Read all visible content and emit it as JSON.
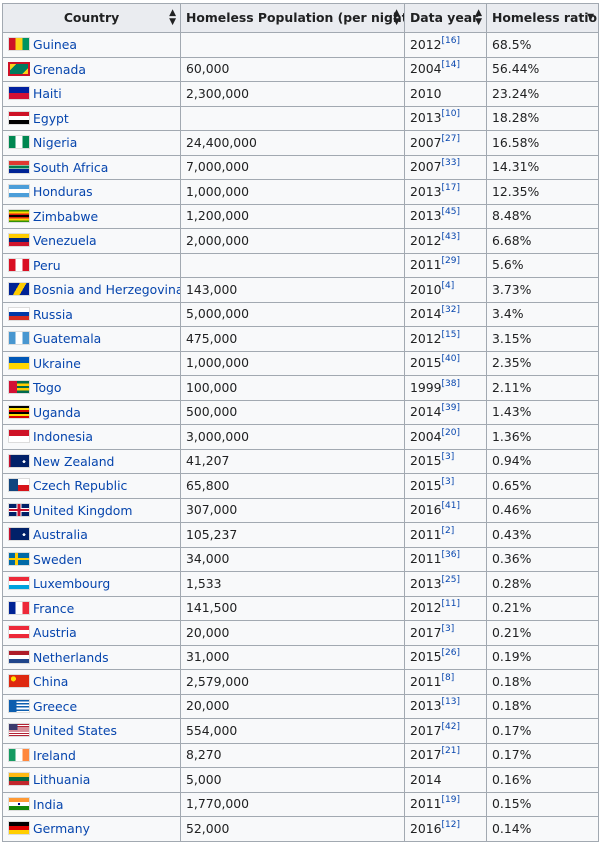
{
  "columns": [
    "Country",
    "Homeless Population (per night)",
    "Data year",
    "Homeless ratio"
  ],
  "rows": [
    {
      "country": "Guinea",
      "pop": "",
      "year": "2012",
      "ref": "[16]",
      "ratio": "68.5%",
      "flag": [
        "v",
        "#ce1126",
        "#fcd116",
        "#009460"
      ]
    },
    {
      "country": "Grenada",
      "pop": "60,000",
      "year": "2004",
      "ref": "[14]",
      "ratio": "56.44%",
      "flag": [
        "x",
        "#ce1126",
        "#fcd116",
        "#007a5e"
      ]
    },
    {
      "country": "Haiti",
      "pop": "2,300,000",
      "year": "2010",
      "ref": "",
      "ratio": "23.24%",
      "flag": [
        "h",
        "#00209f",
        "#d21034"
      ]
    },
    {
      "country": "Egypt",
      "pop": "",
      "year": "2013",
      "ref": "[10]",
      "ratio": "18.28%",
      "flag": [
        "h",
        "#ce1126",
        "#ffffff",
        "#000000"
      ]
    },
    {
      "country": "Nigeria",
      "pop": "24,400,000",
      "year": "2007",
      "ref": "[27]",
      "ratio": "16.58%",
      "flag": [
        "v",
        "#008751",
        "#ffffff",
        "#008751"
      ]
    },
    {
      "country": "South Africa",
      "pop": "7,000,000",
      "year": "2007",
      "ref": "[33]",
      "ratio": "14.31%",
      "flag": [
        "za",
        "#de3831",
        "#007a4d",
        "#002395",
        "#ffb612"
      ]
    },
    {
      "country": "Honduras",
      "pop": "1,000,000",
      "year": "2013",
      "ref": "[17]",
      "ratio": "12.35%",
      "flag": [
        "h",
        "#4c9ed9",
        "#ffffff",
        "#4c9ed9"
      ]
    },
    {
      "country": "Zimbabwe",
      "pop": "1,200,000",
      "year": "2013",
      "ref": "[45]",
      "ratio": "8.48%",
      "flag": [
        "h",
        "#319208",
        "#ffd200",
        "#de2010",
        "#000000",
        "#de2010",
        "#ffd200",
        "#319208"
      ]
    },
    {
      "country": "Venezuela",
      "pop": "2,000,000",
      "year": "2012",
      "ref": "[43]",
      "ratio": "6.68%",
      "flag": [
        "h",
        "#ffcc00",
        "#00247d",
        "#cf142b"
      ]
    },
    {
      "country": "Peru",
      "pop": "",
      "year": "2011",
      "ref": "[29]",
      "ratio": "5.6%",
      "flag": [
        "v",
        "#d91023",
        "#ffffff",
        "#d91023"
      ]
    },
    {
      "country": "Bosnia and Herzegovina",
      "pop": "143,000",
      "year": "2010",
      "ref": "[4]",
      "ratio": "3.73%",
      "flag": [
        "ba",
        "#002395",
        "#fecb00"
      ]
    },
    {
      "country": "Russia",
      "pop": "5,000,000",
      "year": "2014",
      "ref": "[32]",
      "ratio": "3.4%",
      "flag": [
        "h",
        "#ffffff",
        "#0039a6",
        "#d52b1e"
      ]
    },
    {
      "country": "Guatemala",
      "pop": "475,000",
      "year": "2012",
      "ref": "[15]",
      "ratio": "3.15%",
      "flag": [
        "v",
        "#4997d0",
        "#ffffff",
        "#4997d0"
      ]
    },
    {
      "country": "Ukraine",
      "pop": "1,000,000",
      "year": "2015",
      "ref": "[40]",
      "ratio": "2.35%",
      "flag": [
        "h",
        "#0057b7",
        "#ffd700"
      ]
    },
    {
      "country": "Togo",
      "pop": "100,000",
      "year": "1999",
      "ref": "[38]",
      "ratio": "2.11%",
      "flag": [
        "tg",
        "#006a4e",
        "#ffce00",
        "#d21034"
      ]
    },
    {
      "country": "Uganda",
      "pop": "500,000",
      "year": "2014",
      "ref": "[39]",
      "ratio": "1.43%",
      "flag": [
        "h",
        "#000000",
        "#fcdc04",
        "#d90000",
        "#000000",
        "#fcdc04",
        "#d90000"
      ]
    },
    {
      "country": "Indonesia",
      "pop": "3,000,000",
      "year": "2004",
      "ref": "[20]",
      "ratio": "1.36%",
      "flag": [
        "h",
        "#ce1126",
        "#ffffff"
      ]
    },
    {
      "country": "New Zealand",
      "pop": "41,207",
      "year": "2015",
      "ref": "[3]",
      "ratio": "0.94%",
      "flag": [
        "uk",
        "#012169",
        "#c8102e"
      ]
    },
    {
      "country": "Czech Republic",
      "pop": "65,800",
      "year": "2015",
      "ref": "[3]",
      "ratio": "0.65%",
      "flag": [
        "cz",
        "#ffffff",
        "#d7141a",
        "#11457e"
      ]
    },
    {
      "country": "United Kingdom",
      "pop": "307,000",
      "year": "2016",
      "ref": "[41]",
      "ratio": "0.46%",
      "flag": [
        "gb",
        "#012169",
        "#c8102e"
      ]
    },
    {
      "country": "Australia",
      "pop": "105,237",
      "year": "2011",
      "ref": "[2]",
      "ratio": "0.43%",
      "flag": [
        "uk",
        "#012169",
        "#c8102e"
      ]
    },
    {
      "country": "Sweden",
      "pop": "34,000",
      "year": "2011",
      "ref": "[36]",
      "ratio": "0.36%",
      "flag": [
        "nord",
        "#006aa7",
        "#fecc00"
      ]
    },
    {
      "country": "Luxembourg",
      "pop": "1,533",
      "year": "2013",
      "ref": "[25]",
      "ratio": "0.28%",
      "flag": [
        "h",
        "#ed2939",
        "#ffffff",
        "#00a1de"
      ]
    },
    {
      "country": "France",
      "pop": "141,500",
      "year": "2012",
      "ref": "[11]",
      "ratio": "0.21%",
      "flag": [
        "v",
        "#002395",
        "#ffffff",
        "#ed2939"
      ]
    },
    {
      "country": "Austria",
      "pop": "20,000",
      "year": "2017",
      "ref": "[3]",
      "ratio": "0.21%",
      "flag": [
        "h",
        "#ed2939",
        "#ffffff",
        "#ed2939"
      ]
    },
    {
      "country": "Netherlands",
      "pop": "31,000",
      "year": "2015",
      "ref": "[26]",
      "ratio": "0.19%",
      "flag": [
        "h",
        "#ae1c28",
        "#ffffff",
        "#21468b"
      ]
    },
    {
      "country": "China",
      "pop": "2,579,000",
      "year": "2011",
      "ref": "[8]",
      "ratio": "0.18%",
      "flag": [
        "cn",
        "#de2910",
        "#ffde00"
      ]
    },
    {
      "country": "Greece",
      "pop": "20,000",
      "year": "2013",
      "ref": "[13]",
      "ratio": "0.18%",
      "flag": [
        "gr",
        "#0d5eaf",
        "#ffffff"
      ]
    },
    {
      "country": "United States",
      "pop": "554,000",
      "year": "2017",
      "ref": "[42]",
      "ratio": "0.17%",
      "flag": [
        "us",
        "#b22234",
        "#ffffff",
        "#3c3b6e"
      ]
    },
    {
      "country": "Ireland",
      "pop": "8,270",
      "year": "2017",
      "ref": "[21]",
      "ratio": "0.17%",
      "flag": [
        "v",
        "#169b62",
        "#ffffff",
        "#ff883e"
      ]
    },
    {
      "country": "Lithuania",
      "pop": "5,000",
      "year": "2014",
      "ref": "",
      "ratio": "0.16%",
      "flag": [
        "h",
        "#fdb913",
        "#006a44",
        "#c1272d"
      ]
    },
    {
      "country": "India",
      "pop": "1,770,000",
      "year": "2011",
      "ref": "[19]",
      "ratio": "0.15%",
      "flag": [
        "in",
        "#ff9933",
        "#ffffff",
        "#138808"
      ]
    },
    {
      "country": "Germany",
      "pop": "52,000",
      "year": "2016",
      "ref": "[12]",
      "ratio": "0.14%",
      "flag": [
        "h",
        "#000000",
        "#dd0000",
        "#ffce00"
      ]
    }
  ]
}
